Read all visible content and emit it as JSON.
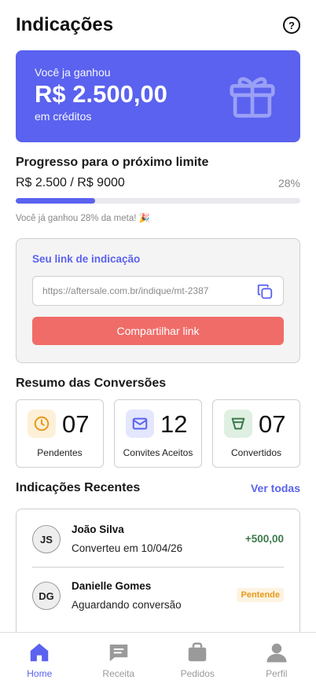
{
  "header": {
    "title": "Indicações",
    "help_icon": "help-circle-icon"
  },
  "earnings": {
    "label": "Você ja ganhou",
    "amount": "R$ 2.500,00",
    "sub": "em créditos",
    "icon": "gift-icon",
    "color": "#5a62ef"
  },
  "progress": {
    "title": "Progresso para o próximo limite",
    "values": "R$ 2.500 / R$ 9000",
    "percent_label": "28%",
    "fraction": 0.28,
    "note": "Você já ganhou 28% da meta! 🎉"
  },
  "referral": {
    "title": "Seu link de indicação",
    "link": "https://aftersale.com.br/indique/mt-2387",
    "copy_icon": "copy-icon",
    "share_label": "Compartilhar link",
    "share_color": "#f06c68"
  },
  "conversions": {
    "title": "Resumo das Conversões",
    "stats": [
      {
        "value": "07",
        "label": "Pendentes",
        "icon": "clock-icon",
        "icon_bg": "#fdf0d8",
        "icon_color": "#e69a1a"
      },
      {
        "value": "12",
        "label": "Convites Aceitos",
        "icon": "mail-icon",
        "icon_bg": "#e3e6fd",
        "icon_color": "#5a62ef"
      },
      {
        "value": "07",
        "label": "Convertidos",
        "icon": "filter-icon",
        "icon_bg": "#dff0e2",
        "icon_color": "#3d7a4d"
      }
    ]
  },
  "recent": {
    "title": "Indicações Recentes",
    "see_all": "Ver todas",
    "items": [
      {
        "initials": "JS",
        "name": "João Silva",
        "status": "Converteu em 10/04/26",
        "amount": "+500,00"
      },
      {
        "initials": "DG",
        "name": "Danielle Gomes",
        "status": "Aguardando conversão",
        "badge": "Pentende"
      }
    ]
  },
  "nav": {
    "items": [
      {
        "label": "Home",
        "icon": "home-icon"
      },
      {
        "label": "Receita",
        "icon": "receipt-icon"
      },
      {
        "label": "Pedidos",
        "icon": "bag-icon"
      },
      {
        "label": "Perfil",
        "icon": "user-icon"
      }
    ]
  }
}
